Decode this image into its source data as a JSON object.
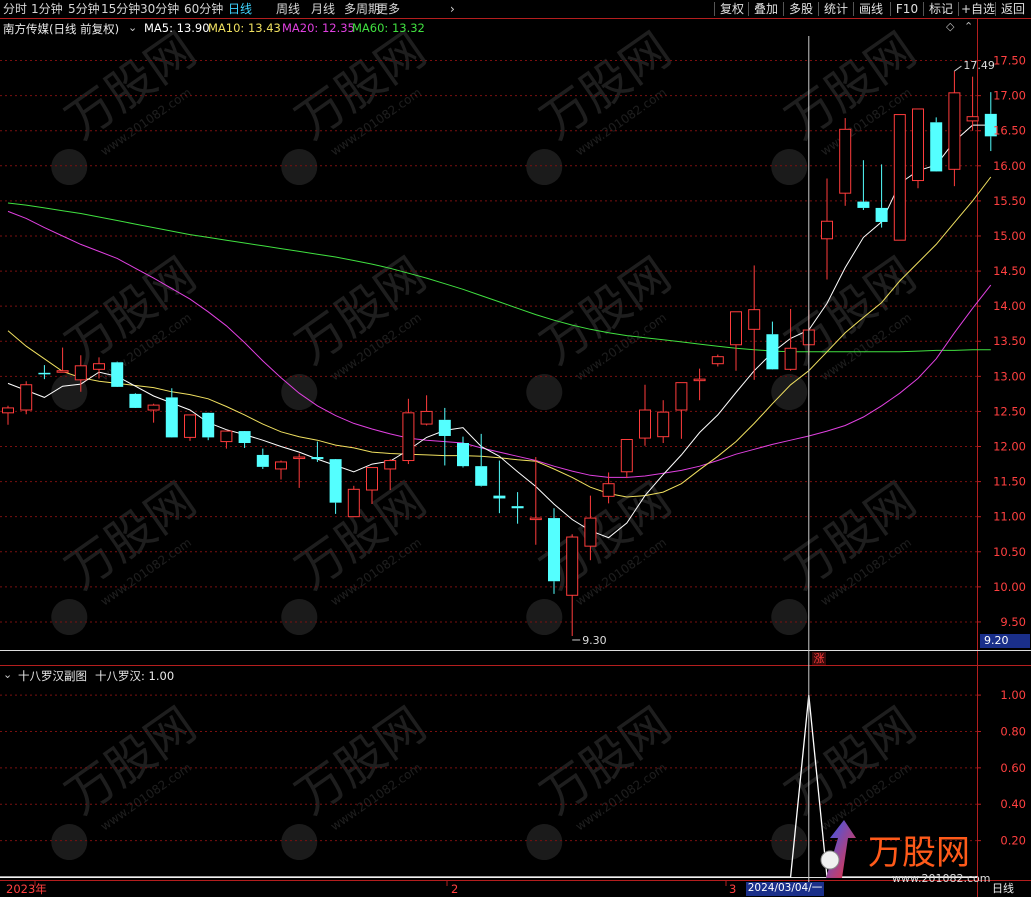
{
  "toolbar": {
    "periods": [
      "分时",
      "1分钟",
      "5分钟",
      "15分钟",
      "30分钟",
      "60分钟",
      "日线",
      "周线",
      "月线",
      "多周期",
      "更多"
    ],
    "active_period": "日线",
    "more_chevron": "›",
    "buttons": [
      "复权",
      "叠加",
      "多股",
      "统计",
      "画线",
      "F10",
      "标记",
      "+自选",
      "返回"
    ]
  },
  "main_panel": {
    "title": "南方传媒(日线 前复权)",
    "ma_labels": [
      {
        "text": "MA5: 13.90",
        "color": "#ffffff"
      },
      {
        "text": "MA10: 13.43",
        "color": "#f0e060"
      },
      {
        "text": "MA20: 12.35",
        "color": "#e040e0"
      },
      {
        "text": "MA60: 13.32",
        "color": "#40e040"
      }
    ],
    "high_label": "17.49",
    "low_label": "9.30",
    "current_price_badge": "9.20",
    "rise_badge": "涨",
    "y_ticks": [
      "17.50",
      "17.00",
      "16.50",
      "16.00",
      "15.50",
      "15.00",
      "14.50",
      "14.00",
      "13.50",
      "13.00",
      "12.50",
      "12.00",
      "11.50",
      "11.00",
      "10.50",
      "10.00",
      "9.50"
    ]
  },
  "sub_panel": {
    "title": "十八罗汉副图",
    "value_label": "十八罗汉: 1.00",
    "y_ticks": [
      "1.00",
      "0.80",
      "0.60",
      "0.40",
      "0.20"
    ]
  },
  "x_axis": {
    "year_label": "2023年",
    "month_2": "2",
    "month_3": "3",
    "cursor_date": "2024/03/04/一",
    "period_label": "日线"
  },
  "watermark": {
    "brand": "万股网",
    "url": "www.201082.com"
  },
  "colors": {
    "up": "#ff3c3c",
    "down": "#54ffff",
    "grid": "#7a1010",
    "cursor": "#cccccc",
    "axis": "#b41e1e",
    "highlight": "#1a2f8a"
  },
  "chart_data": {
    "type": "candlestick",
    "ylim": [
      9.2,
      17.75
    ],
    "candles": [
      [
        12.48,
        12.58,
        12.31,
        12.55
      ],
      [
        12.52,
        12.93,
        12.46,
        12.88
      ],
      [
        13.05,
        13.16,
        12.96,
        13.03
      ],
      [
        13.08,
        13.41,
        13.06,
        13.08
      ],
      [
        12.95,
        13.3,
        12.78,
        13.15
      ],
      [
        13.1,
        13.27,
        12.97,
        13.18
      ],
      [
        13.2,
        13.21,
        12.9,
        12.85
      ],
      [
        12.75,
        12.76,
        12.6,
        12.55
      ],
      [
        12.52,
        12.61,
        12.34,
        12.59
      ],
      [
        12.7,
        12.83,
        12.28,
        12.13
      ],
      [
        12.13,
        12.41,
        12.08,
        12.45
      ],
      [
        12.48,
        12.43,
        12.09,
        12.13
      ],
      [
        12.07,
        12.19,
        11.97,
        12.22
      ],
      [
        12.22,
        12.19,
        11.98,
        12.05
      ],
      [
        11.88,
        11.97,
        11.68,
        11.71
      ],
      [
        11.68,
        11.8,
        11.53,
        11.78
      ],
      [
        11.83,
        11.9,
        11.41,
        11.85
      ],
      [
        11.85,
        12.07,
        11.78,
        11.82
      ],
      [
        11.82,
        11.8,
        11.04,
        11.2
      ],
      [
        11.0,
        11.44,
        11.0,
        11.39
      ],
      [
        11.38,
        11.64,
        11.18,
        11.7
      ],
      [
        11.68,
        11.82,
        11.38,
        11.8
      ],
      [
        11.8,
        12.68,
        11.75,
        12.48
      ],
      [
        12.32,
        12.73,
        12.3,
        12.5
      ],
      [
        12.38,
        12.55,
        11.73,
        12.15
      ],
      [
        12.05,
        12.14,
        11.7,
        11.72
      ],
      [
        11.72,
        12.18,
        11.43,
        11.44
      ],
      [
        11.3,
        11.8,
        11.05,
        11.26
      ],
      [
        11.15,
        11.35,
        10.9,
        11.12
      ],
      [
        10.97,
        11.85,
        10.6,
        10.98
      ],
      [
        10.98,
        11.12,
        9.9,
        10.08
      ],
      [
        9.88,
        10.75,
        9.3,
        10.71
      ],
      [
        10.58,
        11.3,
        10.38,
        10.98
      ],
      [
        11.29,
        11.63,
        11.19,
        11.47
      ],
      [
        11.64,
        12.08,
        11.55,
        12.1
      ],
      [
        12.12,
        12.88,
        12.01,
        12.52
      ],
      [
        12.14,
        12.66,
        12.05,
        12.49
      ],
      [
        12.52,
        12.91,
        12.11,
        12.91
      ],
      [
        12.94,
        13.11,
        12.66,
        12.96
      ],
      [
        13.18,
        13.31,
        13.14,
        13.28
      ],
      [
        13.45,
        13.62,
        13.08,
        13.92
      ],
      [
        13.67,
        14.58,
        12.95,
        13.95
      ],
      [
        13.6,
        13.78,
        13.22,
        13.1
      ],
      [
        13.1,
        13.96,
        13.08,
        13.4
      ],
      [
        13.45,
        13.95,
        13.3,
        13.66
      ],
      [
        14.96,
        15.82,
        14.38,
        15.21
      ],
      [
        15.61,
        16.68,
        15.43,
        16.52
      ],
      [
        15.49,
        16.08,
        15.37,
        15.4
      ],
      [
        15.4,
        16.02,
        15.12,
        15.2
      ],
      [
        14.94,
        16.68,
        14.98,
        16.73
      ],
      [
        15.79,
        16.8,
        15.68,
        16.81
      ],
      [
        16.62,
        16.69,
        15.93,
        15.92
      ],
      [
        15.95,
        17.35,
        15.71,
        17.04
      ],
      [
        16.64,
        17.27,
        16.5,
        16.7
      ],
      [
        16.74,
        17.05,
        16.21,
        16.42
      ]
    ],
    "ma5": [
      12.9,
      12.8,
      12.7,
      12.86,
      12.89,
      13.06,
      13.0,
      12.86,
      12.72,
      12.62,
      12.52,
      12.34,
      12.24,
      12.17,
      12.09,
      12.0,
      11.92,
      11.82,
      11.73,
      11.64,
      11.75,
      11.79,
      11.95,
      12.13,
      12.23,
      12.27,
      12.0,
      11.86,
      11.64,
      11.43,
      11.18,
      10.96,
      10.8,
      10.7,
      10.91,
      11.3,
      11.6,
      11.88,
      12.2,
      12.45,
      12.77,
      13.08,
      13.34,
      13.54,
      13.66,
      14.04,
      14.55,
      14.98,
      15.2,
      15.75,
      15.93,
      16.01,
      16.35,
      16.58,
      16.58
    ],
    "ma10": [
      13.65,
      13.43,
      13.25,
      13.07,
      12.98,
      12.93,
      12.9,
      12.87,
      12.84,
      12.78,
      12.74,
      12.68,
      12.57,
      12.45,
      12.32,
      12.21,
      12.14,
      12.09,
      12.02,
      11.98,
      11.92,
      11.9,
      11.89,
      11.88,
      11.87,
      11.87,
      11.86,
      11.84,
      11.81,
      11.79,
      11.68,
      11.56,
      11.42,
      11.33,
      11.28,
      11.3,
      11.35,
      11.47,
      11.67,
      11.86,
      12.07,
      12.33,
      12.61,
      12.88,
      13.08,
      13.35,
      13.62,
      13.84,
      14.05,
      14.36,
      14.62,
      14.88,
      15.19,
      15.5,
      15.84
    ],
    "ma20": [
      15.35,
      15.25,
      15.12,
      15.0,
      14.88,
      14.78,
      14.68,
      14.54,
      14.4,
      14.25,
      14.1,
      13.92,
      13.72,
      13.48,
      13.22,
      12.98,
      12.76,
      12.58,
      12.44,
      12.33,
      12.25,
      12.18,
      12.12,
      12.09,
      12.07,
      12.05,
      11.98,
      11.92,
      11.86,
      11.8,
      11.72,
      11.65,
      11.59,
      11.56,
      11.56,
      11.58,
      11.62,
      11.66,
      11.72,
      11.8,
      11.89,
      11.96,
      12.03,
      12.09,
      12.15,
      12.22,
      12.3,
      12.42,
      12.58,
      12.76,
      12.97,
      13.25,
      13.62,
      13.97,
      14.3
    ],
    "ma60": [
      15.47,
      15.44,
      15.4,
      15.36,
      15.32,
      15.27,
      15.22,
      15.17,
      15.12,
      15.07,
      15.02,
      14.98,
      14.94,
      14.9,
      14.86,
      14.82,
      14.78,
      14.74,
      14.7,
      14.65,
      14.6,
      14.54,
      14.47,
      14.4,
      14.32,
      14.24,
      14.15,
      14.06,
      13.97,
      13.88,
      13.8,
      13.73,
      13.67,
      13.62,
      13.58,
      13.55,
      13.52,
      13.49,
      13.46,
      13.43,
      13.4,
      13.38,
      13.36,
      13.35,
      13.35,
      13.35,
      13.35,
      13.35,
      13.35,
      13.35,
      13.36,
      13.37,
      13.37,
      13.38,
      13.38
    ],
    "indicator_ylim": [
      0,
      1.05
    ],
    "indicator_signal_index": 44,
    "indicator_signal_value": 1.0
  }
}
